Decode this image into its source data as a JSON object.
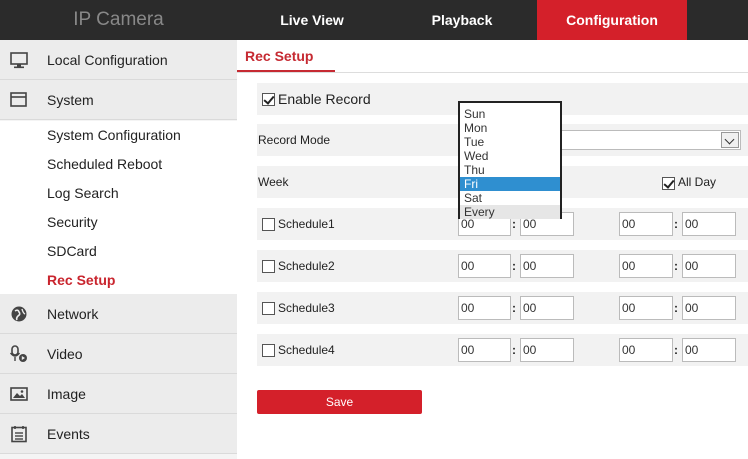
{
  "header": {
    "brand": "IP Camera",
    "nav": [
      {
        "label": "Live View"
      },
      {
        "label": "Playback"
      },
      {
        "label": "Configuration",
        "active": true
      }
    ]
  },
  "sidebar": {
    "items": [
      {
        "label": "Local Configuration",
        "icon": "monitor-icon"
      },
      {
        "label": "System",
        "icon": "window-icon",
        "expanded": true
      },
      {
        "label": "Network",
        "icon": "globe-icon"
      },
      {
        "label": "Video",
        "icon": "microphone-icon"
      },
      {
        "label": "Image",
        "icon": "image-icon"
      },
      {
        "label": "Events",
        "icon": "calendar-icon"
      }
    ],
    "system_sub": [
      {
        "label": "System Configuration"
      },
      {
        "label": "Scheduled Reboot"
      },
      {
        "label": "Log Search"
      },
      {
        "label": "Security"
      },
      {
        "label": "SDCard"
      },
      {
        "label": "Rec Setup",
        "active": true
      }
    ]
  },
  "main": {
    "tab": "Rec Setup",
    "enable_record": {
      "label": "Enable Record",
      "checked": true
    },
    "record_mode": {
      "label": "Record Mode",
      "value": ""
    },
    "week": {
      "label": "Week",
      "all_day_label": "All Day",
      "all_day_checked": true
    },
    "schedules": [
      {
        "label": "Schedule1",
        "start_h": "00",
        "start_m": "00",
        "end_h": "00",
        "end_m": "00"
      },
      {
        "label": "Schedule2",
        "start_h": "00",
        "start_m": "00",
        "end_h": "00",
        "end_m": "00"
      },
      {
        "label": "Schedule3",
        "start_h": "00",
        "start_m": "00",
        "end_h": "00",
        "end_m": "00"
      },
      {
        "label": "Schedule4",
        "start_h": "00",
        "start_m": "00",
        "end_h": "00",
        "end_m": "00"
      }
    ],
    "colon": ":",
    "week_options": [
      "Sun",
      "Mon",
      "Tue",
      "Wed",
      "Thu",
      "Fri",
      "Sat",
      "Every"
    ],
    "week_selected": "Fri",
    "save_label": "Save"
  },
  "colors": {
    "accent": "#d4202a",
    "topbar": "#2b2b2b",
    "selection": "#2f8fd0"
  }
}
